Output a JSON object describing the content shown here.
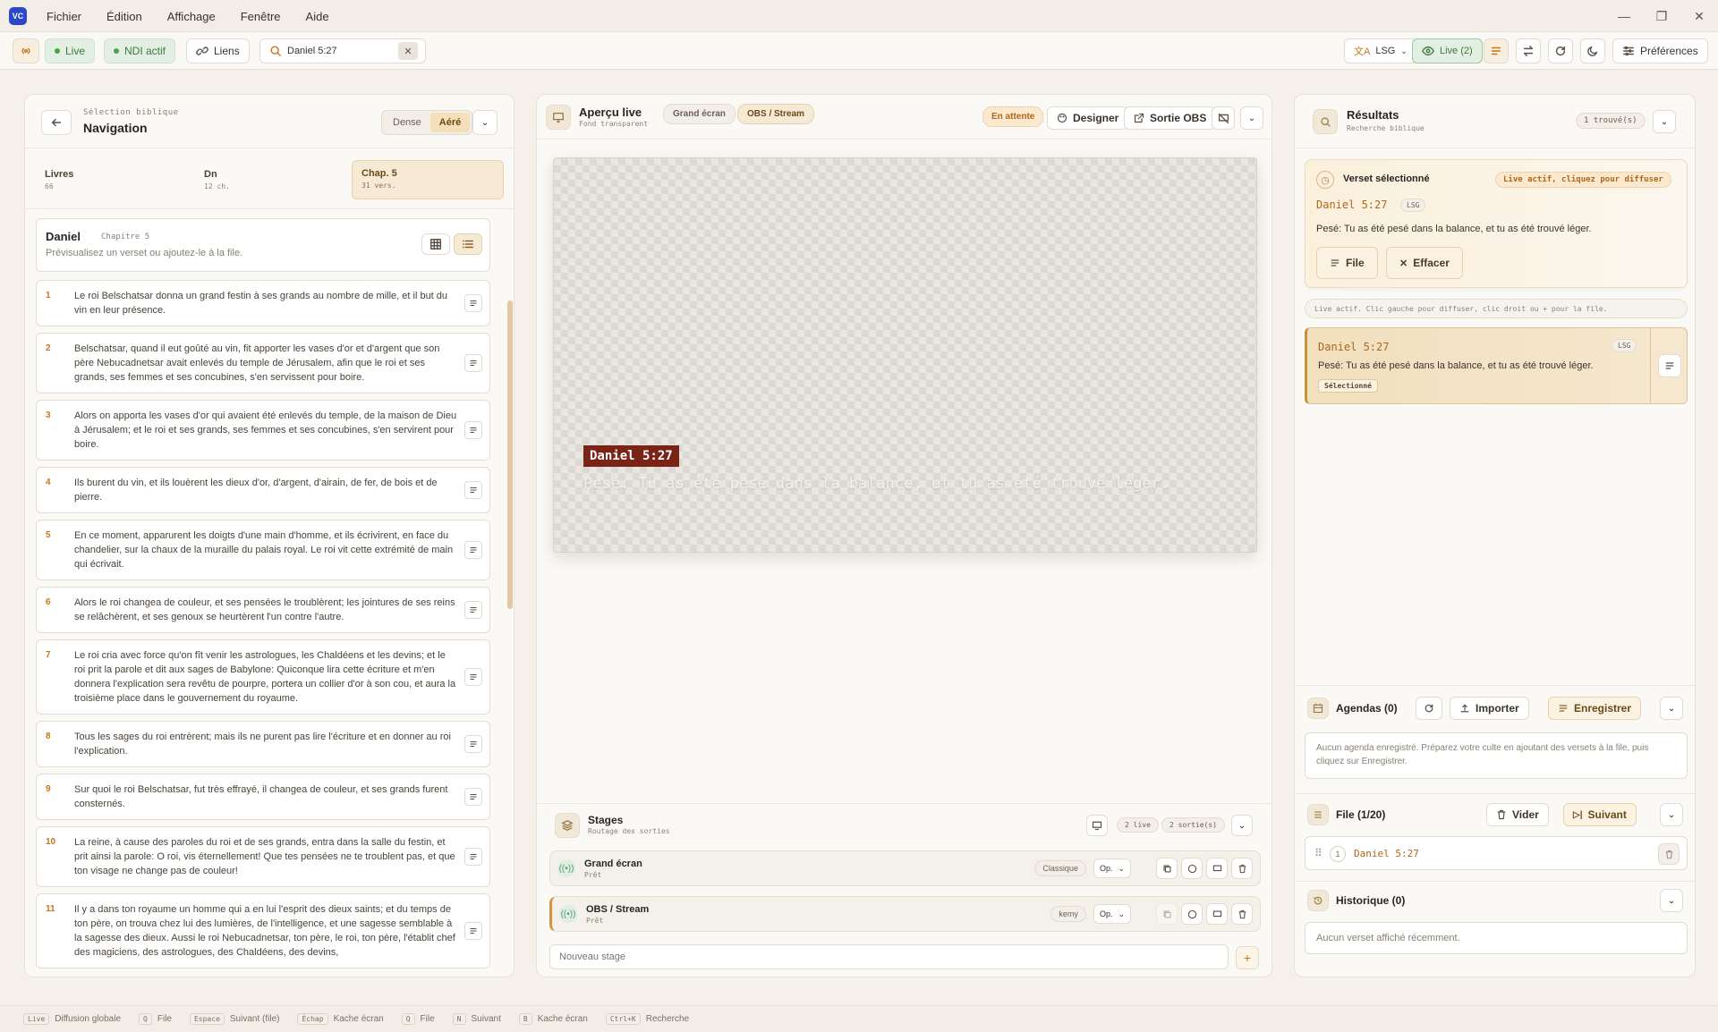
{
  "app": {
    "icon_text": "VC"
  },
  "menu": [
    "Fichier",
    "Édition",
    "Affichage",
    "Fenêtre",
    "Aide"
  ],
  "toolbar": {
    "live_label": "Live",
    "ndi_label": "NDI actif",
    "links_label": "Liens",
    "search_value": "Daniel 5:27",
    "lang_label": "LSG",
    "live_count_label": "Live (2)",
    "prefs_label": "Préférences"
  },
  "nav": {
    "eyebrow": "Sélection biblique",
    "title": "Navigation",
    "density": [
      "Dense",
      "Aéré"
    ],
    "density_active": "Aéré",
    "tabs": [
      {
        "label": "Livres",
        "sub": "66"
      },
      {
        "label": "Dn",
        "sub": "12 ch."
      },
      {
        "label": "Chap. 5",
        "sub": "31 vers."
      }
    ],
    "book": "Daniel",
    "chapter": "Chapitre 5",
    "hint": "Prévisualisez un verset ou ajoutez-le à la file.",
    "verses": [
      {
        "n": "1",
        "t": "Le roi Belschatsar donna un grand festin à ses grands au nombre de mille, et il but du vin en leur présence."
      },
      {
        "n": "2",
        "t": "Belschatsar, quand il eut goûté au vin, fit apporter les vases d'or et d'argent que son père Nebucadnetsar avait enlevés du temple de Jérusalem, afin que le roi et ses grands, ses femmes et ses concubines, s'en servissent pour boire."
      },
      {
        "n": "3",
        "t": "Alors on apporta les vases d'or qui avaient été enlevés du temple, de la maison de Dieu à Jérusalem; et le roi et ses grands, ses femmes et ses concubines, s'en servirent pour boire."
      },
      {
        "n": "4",
        "t": "Ils burent du vin, et ils louèrent les dieux d'or, d'argent, d'airain, de fer, de bois et de pierre."
      },
      {
        "n": "5",
        "t": "En ce moment, apparurent les doigts d'une main d'homme, et ils écrivirent, en face du chandelier, sur la chaux de la muraille du palais royal. Le roi vit cette extrémité de main qui écrivait."
      },
      {
        "n": "6",
        "t": "Alors le roi changea de couleur, et ses pensées le troublèrent; les jointures de ses reins se relâchèrent, et ses genoux se heurtèrent l'un contre l'autre."
      },
      {
        "n": "7",
        "t": "Le roi cria avec force qu'on fît venir les astrologues, les Chaldéens et les devins; et le roi prit la parole et dit aux sages de Babylone: Quiconque lira cette écriture et m'en donnera l'explication sera revêtu de pourpre, portera un collier d'or à son cou, et aura la troisième place dans le gouvernement du royaume."
      },
      {
        "n": "8",
        "t": "Tous les sages du roi entrèrent; mais ils ne purent pas lire l'écriture et en donner au roi l'explication."
      },
      {
        "n": "9",
        "t": "Sur quoi le roi Belschatsar, fut très effrayé, il changea de couleur, et ses grands furent consternés."
      },
      {
        "n": "10",
        "t": "La reine, à cause des paroles du roi et de ses grands, entra dans la salle du festin, et prit ainsi la parole: O roi, vis éternellement! Que tes pensées ne te troublent pas, et que ton visage ne change pas de couleur!"
      },
      {
        "n": "11",
        "t": "Il y a dans ton royaume un homme qui a en lui l'esprit des dieux saints; et du temps de ton père, on trouva chez lui des lumières, de l'intelligence, et une sagesse semblable à la sagesse des dieux. Aussi le roi Nebucadnetsar, ton père, le roi, ton père, l'établit chef des magiciens, des astrologues, des Chaldéens, des devins,"
      }
    ]
  },
  "preview": {
    "title": "Aperçu live",
    "subtitle": "Fond transparent",
    "tab1": "Grand écran",
    "tab2": "OBS / Stream",
    "status": "En attente",
    "designer": "Designer",
    "obs_out": "Sortie OBS",
    "ref": "Daniel 5:27",
    "text": "Pesé: Tu as été pesé dans la balance, et tu as été trouvé léger."
  },
  "stages": {
    "title": "Stages",
    "subtitle": "Routage des sorties",
    "live_count": "2 live",
    "out_count": "2 sortie(s)",
    "items": [
      {
        "name": "Grand écran",
        "status": "Prêt",
        "theme": "Classique",
        "op": "Op."
      },
      {
        "name": "OBS / Stream",
        "status": "Prêt",
        "theme": "kemy",
        "op": "Op."
      }
    ],
    "new_placeholder": "Nouveau stage"
  },
  "results": {
    "title": "Résultats",
    "subtitle": "Recherche biblique",
    "count": "1 trouvé(s)",
    "selected_title": "Verset sélectionné",
    "live_hint": "Live actif, cliquez pour diffuser",
    "ref": "Daniel 5:27",
    "lang": "LSG",
    "text": "Pesé: Tu as été pesé dans la balance, et tu as été trouvé léger.",
    "queue_btn": "File",
    "clear_btn": "Effacer",
    "info": "Live actif. Clic gauche pour diffuser, clic droit ou + pour la file.",
    "card_ref": "Daniel 5:27",
    "card_lang": "LSG",
    "card_text": "Pesé: Tu as été pesé dans la balance, et tu as été trouvé léger.",
    "card_tag": "Sélectionné"
  },
  "agendas": {
    "title": "Agendas (0)",
    "import": "Importer",
    "save": "Enregistrer",
    "empty": "Aucun agenda enregistré. Préparez votre culte en ajoutant des versets à la file, puis cliquez sur Enregistrer."
  },
  "queue": {
    "title": "File (1/20)",
    "clear": "Vider",
    "next": "Suivant",
    "item_index": "1",
    "item_ref": "Daniel 5:27"
  },
  "history": {
    "title": "Historique (0)",
    "empty": "Aucun verset affiché récemment."
  },
  "footer": [
    {
      "key": "Live",
      "label": "Diffusion globale"
    },
    {
      "key": "Q",
      "label": "File"
    },
    {
      "key": "Espace",
      "label": "Suivant (file)"
    },
    {
      "key": "Échap",
      "label": "Kache écran"
    },
    {
      "key": "Q",
      "label": "File"
    },
    {
      "key": "N",
      "label": "Suivant"
    },
    {
      "key": "B",
      "label": "Kache écran"
    },
    {
      "key": "Ctrl+K",
      "label": "Recherche"
    }
  ],
  "colors": {
    "accent": "#c7761c",
    "live_green": "#47a447",
    "brand": "#2b48c8"
  }
}
